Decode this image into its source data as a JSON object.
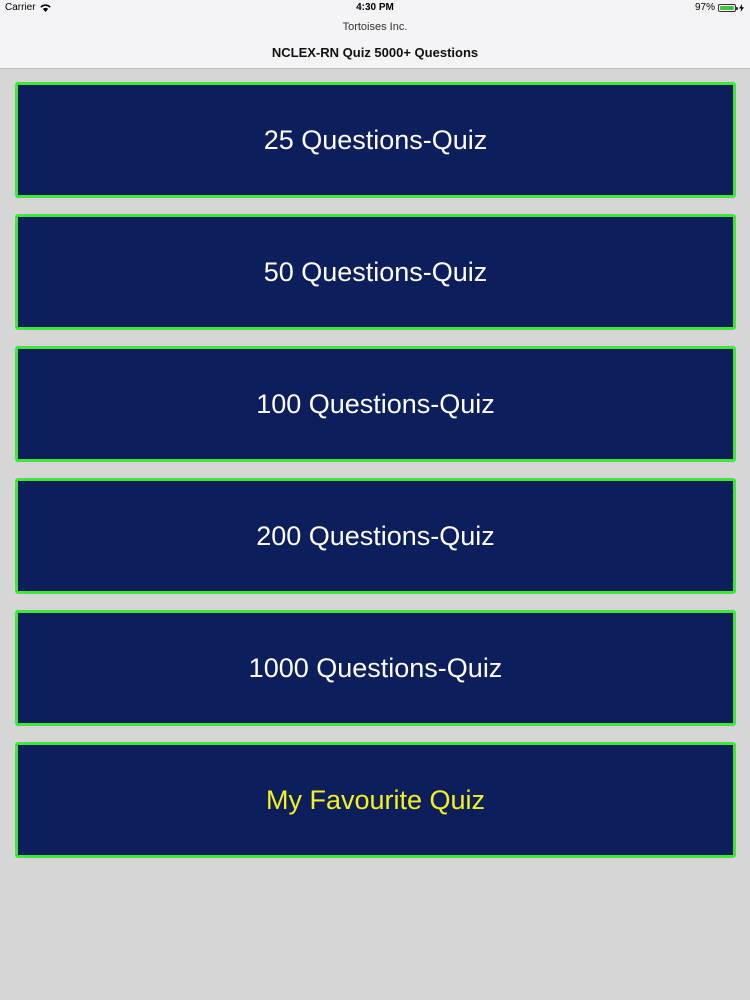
{
  "status_bar": {
    "carrier": "Carrier",
    "time": "4:30 PM",
    "battery": "97%",
    "battery_level": 0.97
  },
  "header": {
    "subtitle": "Tortoises Inc.",
    "title": "NCLEX-RN Quiz 5000+ Questions"
  },
  "menu": {
    "items": [
      {
        "label": "25 Questions-Quiz"
      },
      {
        "label": "50 Questions-Quiz"
      },
      {
        "label": "100 Questions-Quiz"
      },
      {
        "label": "200 Questions-Quiz"
      },
      {
        "label": "1000 Questions-Quiz"
      },
      {
        "label": "My Favourite Quiz"
      }
    ]
  },
  "colors": {
    "button_bg": "#0d1e5c",
    "button_border": "#3ee83a",
    "button_text": "#ffffff",
    "favourite_text": "#f3f21b"
  }
}
